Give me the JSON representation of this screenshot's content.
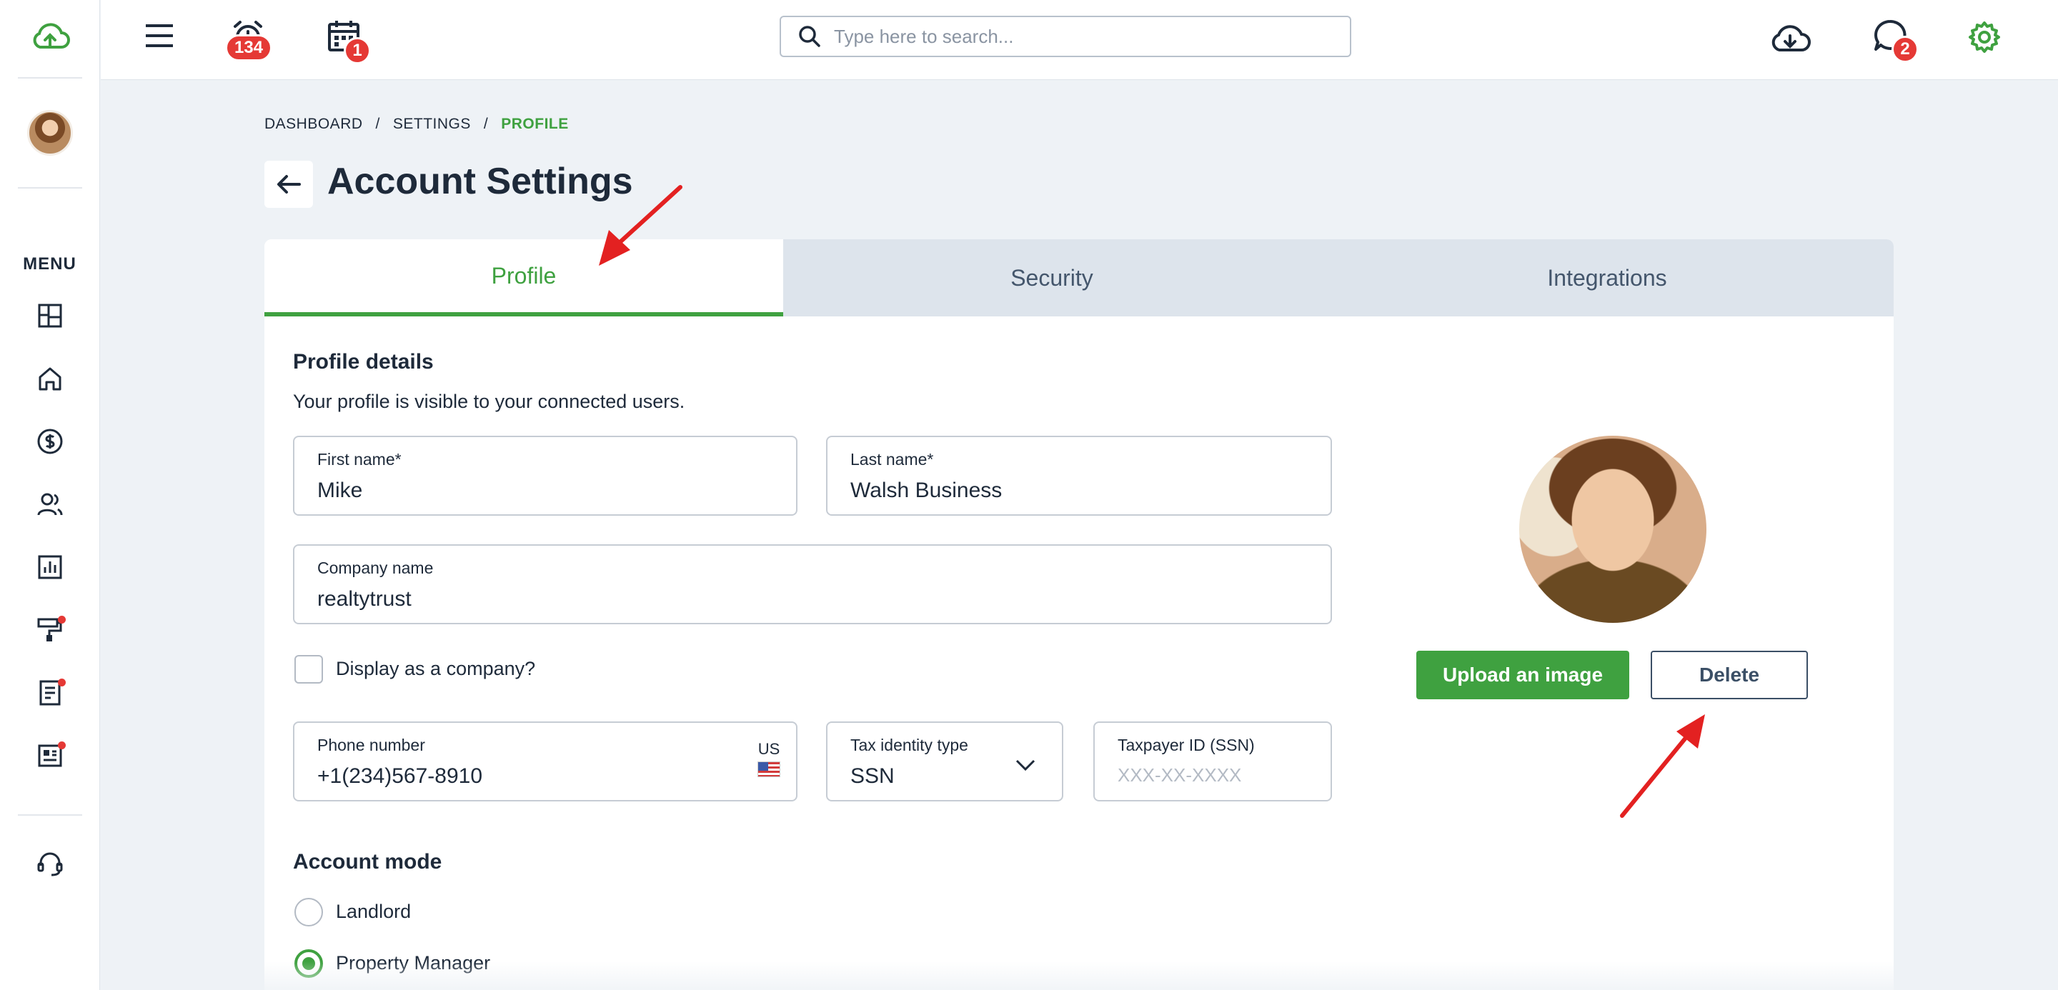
{
  "colors": {
    "accent": "#3fa140",
    "badge": "#e53935",
    "annotation": "#e32121"
  },
  "sidebar": {
    "menu_label": "MENU",
    "items": [
      {
        "icon": "dashboard-icon"
      },
      {
        "icon": "home-icon"
      },
      {
        "icon": "dollar-icon"
      },
      {
        "icon": "users-icon"
      },
      {
        "icon": "reports-icon"
      },
      {
        "icon": "paint-roller-icon"
      },
      {
        "icon": "document-icon"
      },
      {
        "icon": "newspaper-icon"
      }
    ],
    "support_icon": "headset-icon"
  },
  "topbar": {
    "notifications_badge": "134",
    "calendar_badge": "1",
    "messages_badge": "2",
    "search_placeholder": "Type here to search..."
  },
  "breadcrumb": [
    "DASHBOARD",
    "SETTINGS",
    "PROFILE"
  ],
  "breadcrumb_sep": "/",
  "page_title": "Account Settings",
  "tabs": [
    "Profile",
    "Security",
    "Integrations"
  ],
  "profile": {
    "section_title": "Profile details",
    "section_sub": "Your profile is visible to your connected users.",
    "first_name_label": "First name*",
    "first_name": "Mike",
    "last_name_label": "Last name*",
    "last_name": "Walsh Business",
    "company_label": "Company name",
    "company": "realtytrust",
    "display_company_label": "Display as a company?",
    "phone_label": "Phone number",
    "phone": "+1(234)567-8910",
    "country": "US",
    "tax_type_label": "Tax identity type",
    "tax_type": "SSN",
    "taxpayer_label": "Taxpayer ID (SSN)",
    "taxpayer_placeholder": "XXX-XX-XXXX",
    "upload_label": "Upload an image",
    "delete_label": "Delete"
  },
  "account_mode": {
    "title": "Account mode",
    "options": [
      "Landlord",
      "Property Manager"
    ],
    "selected": "Property Manager"
  }
}
